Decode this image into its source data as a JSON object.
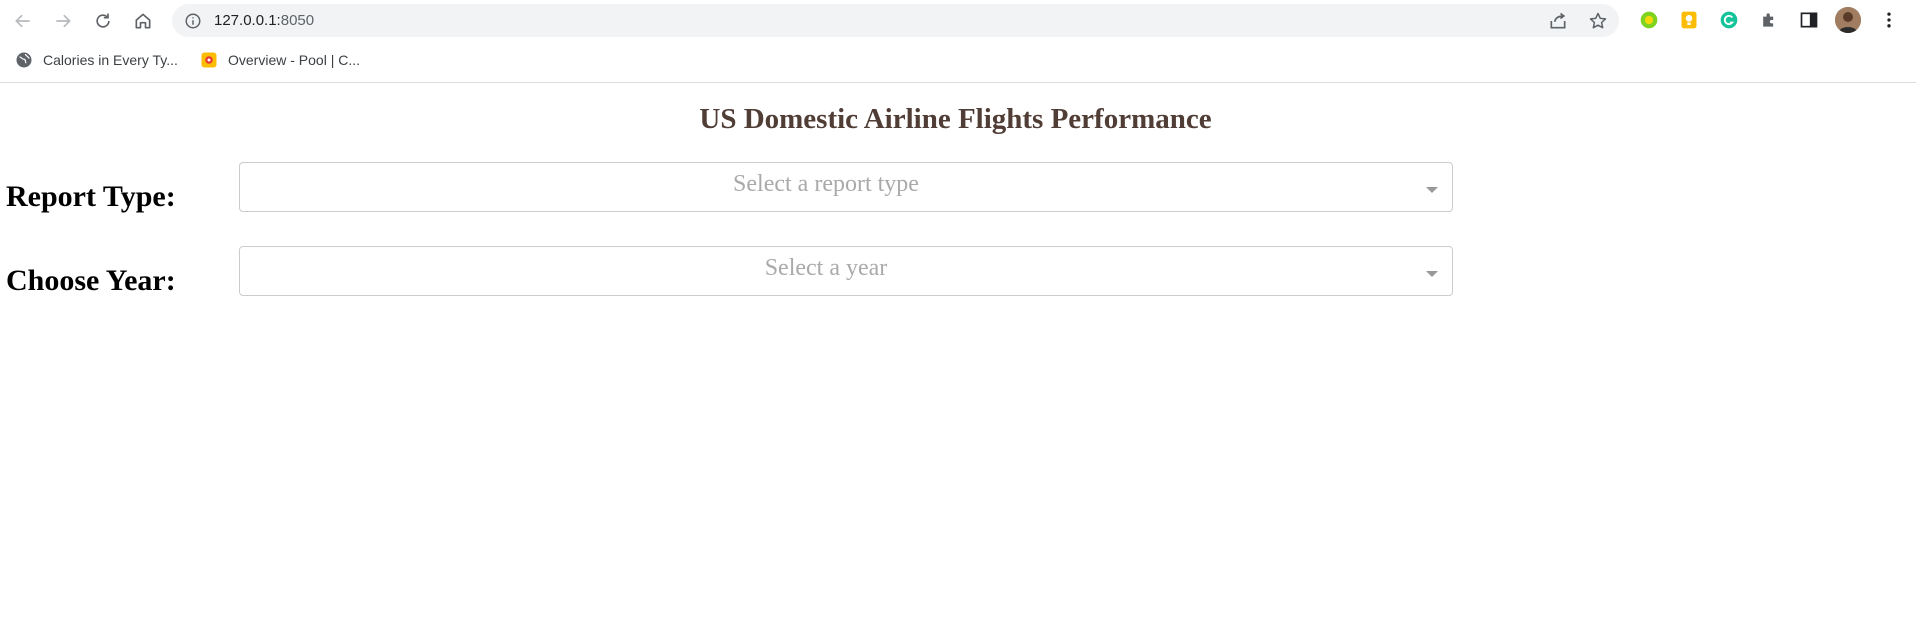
{
  "browser": {
    "url_host": "127.0.0.1:",
    "url_port": "8050",
    "bookmarks": [
      {
        "label": "Calories in Every Ty...",
        "icon": "globe-icon"
      },
      {
        "label": "Overview - Pool | C...",
        "icon": "pool-icon"
      }
    ],
    "extensions": [
      "greenleaf-extension-icon",
      "keep-notes-icon",
      "grammarly-icon",
      "puzzle-icon",
      "side-panel-icon"
    ],
    "colors": {
      "omnibox": "#f1f3f4",
      "grammarly": "#15c39a",
      "keep": "#fbbc04"
    }
  },
  "dashboard": {
    "title": "US Domestic Airline Flights Performance",
    "report_type": {
      "label": "Report Type:",
      "placeholder": "Select a report type"
    },
    "year": {
      "label": "Choose Year:",
      "placeholder": "Select a year"
    },
    "colors": {
      "title": "#503d36",
      "placeholder": "#aaaaaa",
      "border": "#cccccc"
    }
  }
}
